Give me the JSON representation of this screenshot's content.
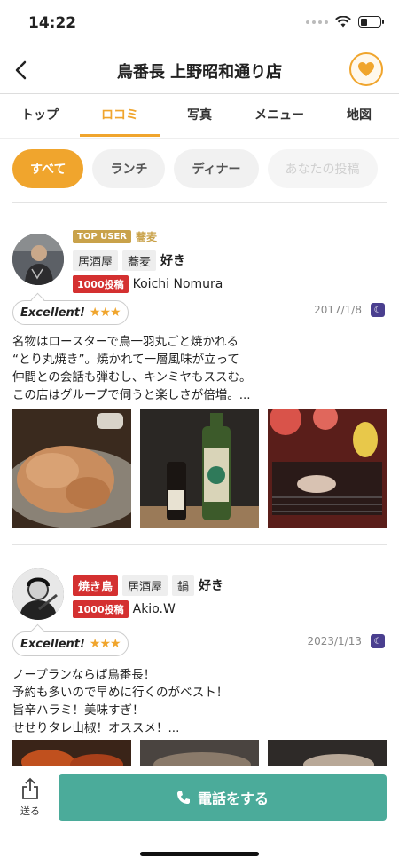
{
  "status": {
    "time": "14:22"
  },
  "header": {
    "title": "鳥番長 上野昭和通り店"
  },
  "tabs": [
    {
      "label": "トップ"
    },
    {
      "label": "ロコミ"
    },
    {
      "label": "写真"
    },
    {
      "label": "メニュー"
    },
    {
      "label": "地図"
    }
  ],
  "filters": [
    "すべて",
    "ランチ",
    "ディナー",
    "あなたの投稿"
  ],
  "reviews": [
    {
      "top_badge": "TOP USER",
      "top_category": "蕎麦",
      "tags": [
        "居酒屋",
        "蕎麦"
      ],
      "like": "好き",
      "posts": "1000投稿",
      "user": "Koichi  Nomura",
      "rating": "Excellent!",
      "stars": "★★★",
      "date": "2017/1/8",
      "text": [
        "名物はロースターで鳥一羽丸ごと焼かれる",
        "“とり丸焼き”。焼かれて一層風味が立って",
        "仲間との会話も弾むし、キンミヤもススむ。",
        "この店はグループで伺うと楽しさが倍増。..."
      ]
    },
    {
      "first_tag": "焼き鳥",
      "tags": [
        "居酒屋",
        "鍋"
      ],
      "like": "好き",
      "posts": "1000投稿",
      "user": "Akio.W",
      "rating": "Excellent!",
      "stars": "★★★",
      "date": "2023/1/13",
      "text": [
        "ノープランならば鳥番長！",
        "予約も多いので早めに行くのがベスト！",
        "旨辛ハラミ！美味すぎ！",
        "せせりタレ山椒！オススメ！..."
      ]
    }
  ],
  "bottom": {
    "share_label": "送る",
    "call_label": "電話をする"
  },
  "colors": {
    "accent": "#f0a52d",
    "call": "#4bab9a",
    "tag_red": "#d43030",
    "gold": "#c9a24a"
  }
}
